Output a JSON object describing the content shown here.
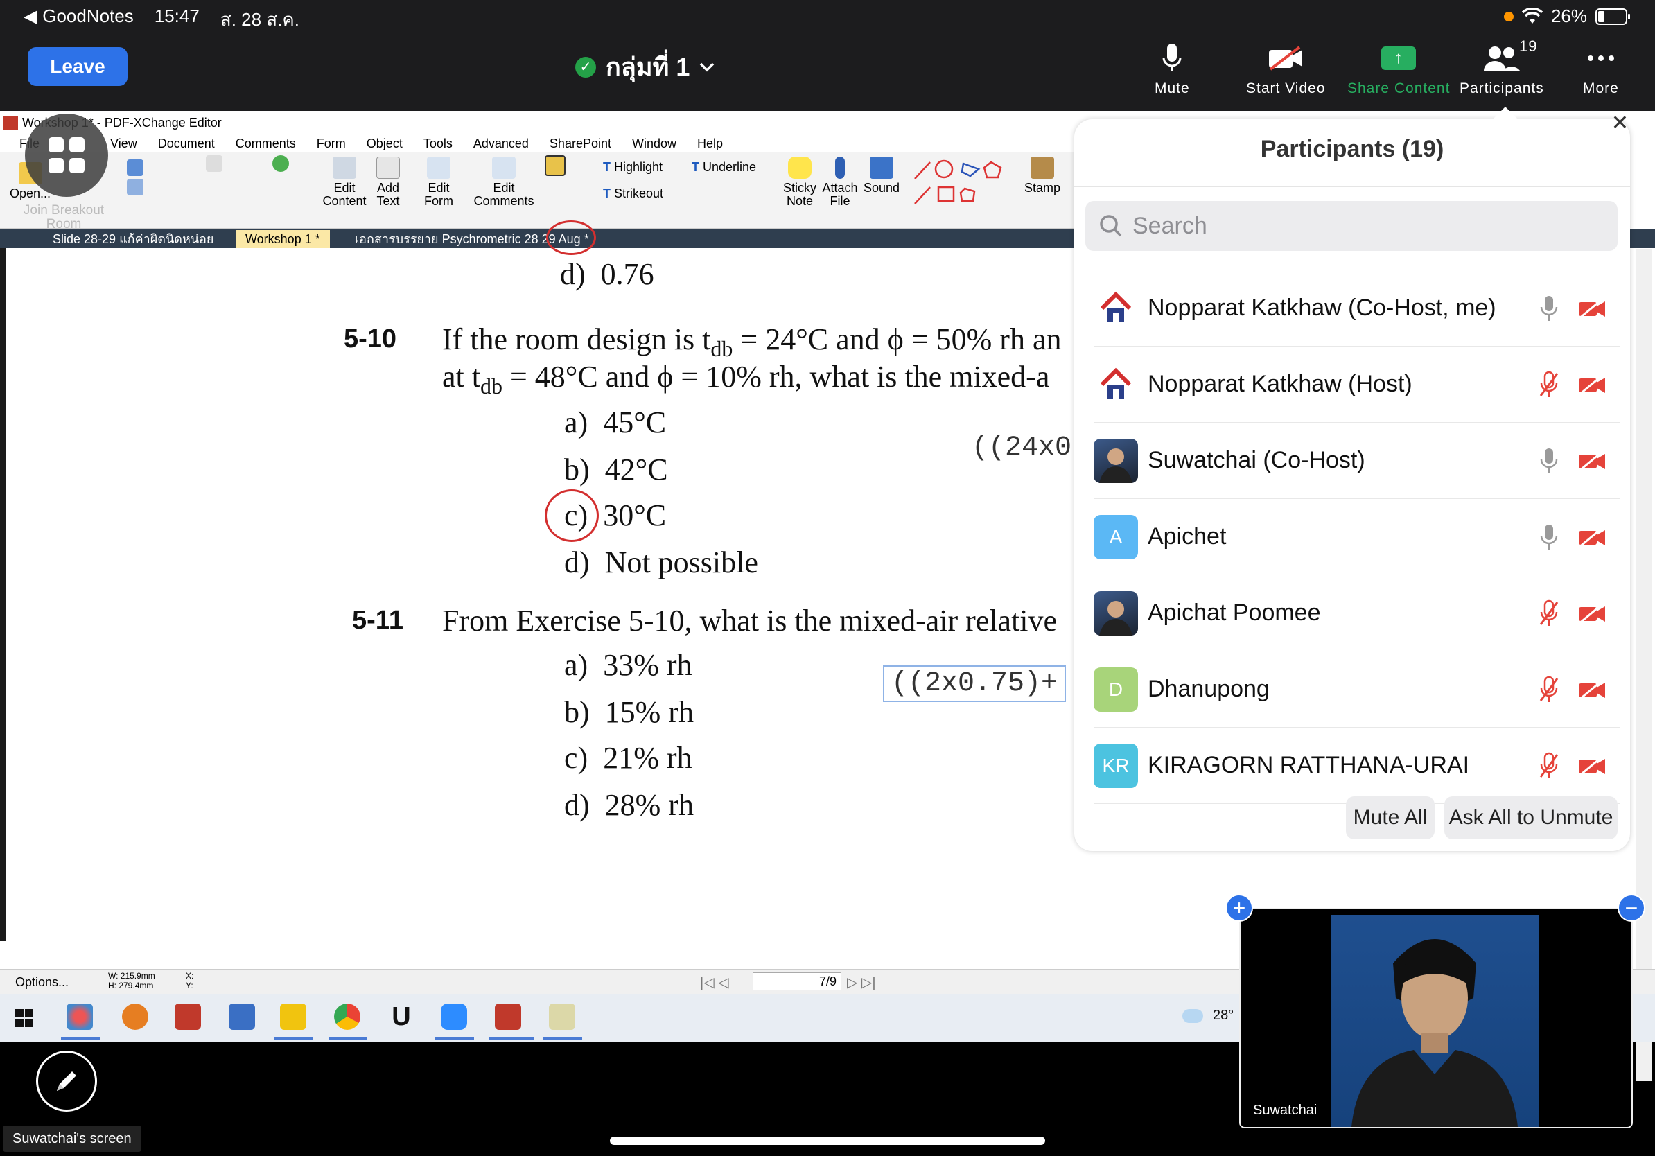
{
  "status_bar": {
    "back_app": "GoodNotes",
    "time": "15:47",
    "date": "ส. 28 ส.ค.",
    "battery": "26%"
  },
  "zoom": {
    "leave_label": "Leave",
    "meeting_title": "กลุ่มที่ 1",
    "controls": {
      "mute": "Mute",
      "start_video": "Start Video",
      "share_content": "Share Content",
      "participants": "Participants",
      "participants_count": "19",
      "more": "More"
    },
    "apps_label": "Join Breakout Room"
  },
  "shared_screen": {
    "window_title": "Workshop 1* - PDF-XChange Editor",
    "menu": [
      "File",
      "View",
      "Document",
      "Comments",
      "Form",
      "Object",
      "Tools",
      "Advanced",
      "SharePoint",
      "Window",
      "Help"
    ],
    "ribbon": {
      "open": "Open...",
      "edit_content": "Edit Content",
      "add_text": "Add Text",
      "edit_form": "Edit Form",
      "edit_comments": "Edit Comments",
      "highlight": "Highlight",
      "underline": "Underline",
      "strikeout": "Strikeout",
      "sticky_note": "Sticky Note",
      "attach_file": "Attach File",
      "sound": "Sound",
      "stamp": "Stamp"
    },
    "tabs": [
      "Slide 28-29 แก้ค่าผิดนิดหน่อย",
      "Workshop 1 *",
      "เอกสารบรรยาย Psychrometric 28 29 Aug *"
    ],
    "document": {
      "prev_option": {
        "letter": "d)",
        "text": "0.76"
      },
      "q10": {
        "number": "5-10",
        "line1": "If the room design is t",
        "line1_sub": "db",
        "line1_rest": " = 24°C and ϕ = 50% rh an",
        "line2": "at t",
        "line2_sub": "db",
        "line2_rest": " = 48°C and ϕ = 10% rh, what is the mixed-a",
        "options": [
          {
            "letter": "a)",
            "text": "45°C"
          },
          {
            "letter": "b)",
            "text": "42°C"
          },
          {
            "letter": "c)",
            "text": "30°C"
          },
          {
            "letter": "d)",
            "text": "Not possible"
          }
        ],
        "annotation": "((24x0"
      },
      "q11": {
        "number": "5-11",
        "line1": "From Exercise 5-10, what is the mixed-air relative",
        "options": [
          {
            "letter": "a)",
            "text": "33% rh"
          },
          {
            "letter": "b)",
            "text": "15% rh"
          },
          {
            "letter": "c)",
            "text": "21% rh"
          },
          {
            "letter": "d)",
            "text": "28% rh"
          }
        ],
        "annotation": "((2x0.75)+"
      }
    },
    "status": {
      "options": "Options...",
      "width": "W: 215.9mm",
      "height": "H: 279.4mm",
      "x": "X:",
      "y": "Y:",
      "page": "7/9"
    },
    "taskbar": {
      "weather": "28°"
    }
  },
  "participants_panel": {
    "title": "Participants (19)",
    "search_placeholder": "Search",
    "participants": [
      {
        "name": "Nopparat Katkhaw (Co-Host, me)",
        "avatar": "logo",
        "mic": "on",
        "video": "off"
      },
      {
        "name": "Nopparat Katkhaw (Host)",
        "avatar": "logo",
        "mic": "muted",
        "video": "off"
      },
      {
        "name": "Suwatchai (Co-Host)",
        "avatar": "photo",
        "mic": "on",
        "video": "off"
      },
      {
        "name": "Apichet",
        "avatar_initials": "A",
        "avatar_color": "#5bb8f5",
        "mic": "on",
        "video": "off"
      },
      {
        "name": "Apichat Poomee",
        "avatar": "photo",
        "mic": "muted",
        "video": "off"
      },
      {
        "name": "Dhanupong",
        "avatar_initials": "D",
        "avatar_color": "#a8d47a",
        "mic": "muted",
        "video": "off"
      },
      {
        "name": "KIRAGORN RATTHANA-URAI",
        "avatar_initials": "KR",
        "avatar_color": "#4cc3e0",
        "mic": "muted",
        "video": "off"
      }
    ],
    "mute_all": "Mute All",
    "ask_all_unmute": "Ask All to Unmute"
  },
  "video_tile": {
    "name": "Suwatchai"
  },
  "screen_label": "Suwatchai's screen",
  "colors": {
    "accent": "#2d72e8",
    "share_green": "#27ae60",
    "muted_red": "#e5433a",
    "annotation_red": "#d32f2f"
  }
}
